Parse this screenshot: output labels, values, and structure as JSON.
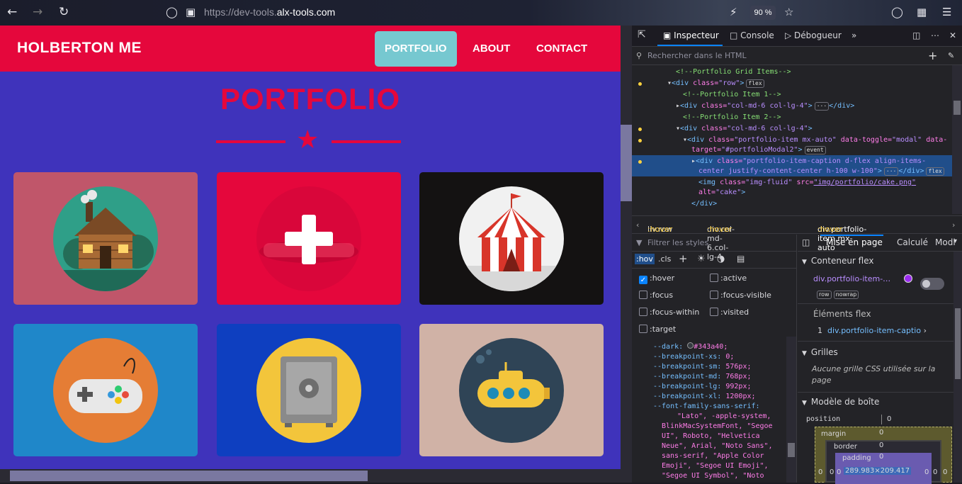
{
  "browser": {
    "url_prefix": "https://dev-tools.",
    "url_domain": "alx-tools.com",
    "zoom": "90 %"
  },
  "site": {
    "brand": "HOLBERTON ME",
    "nav": [
      "PORTFOLIO",
      "ABOUT",
      "CONTACT"
    ],
    "section_title": "PORTFOLIO",
    "colors": {
      "navbar": "#e5073c",
      "page": "#3f33bb",
      "active_nav": "#76c8d0"
    },
    "items": [
      {
        "icon": "cabin-icon",
        "bg": "#c0566a"
      },
      {
        "icon": "cake-icon",
        "bg": "#e5073c"
      },
      {
        "icon": "circus-tent-icon",
        "bg": "#141212"
      },
      {
        "icon": "game-controller-icon",
        "bg": "#1f87c9"
      },
      {
        "icon": "safe-icon",
        "bg": "#0e3fc0"
      },
      {
        "icon": "submarine-icon",
        "bg": "#d0b2a6"
      }
    ]
  },
  "devtools": {
    "tabs": [
      "Inspecteur",
      "Console",
      "Débogueur"
    ],
    "search_placeholder": "Rechercher dans le HTML",
    "tree": {
      "l1": "<!--Portfolio Grid Items-->",
      "l2_tag": "<div ",
      "l2_attr": "class=",
      "l2_val": "\"row\"",
      "l2_end": ">",
      "l2_badge": "flex",
      "l3": "<!--Portfolio Item 1-->",
      "l4_tag": "<div ",
      "l4_attr": "class=",
      "l4_val": "\"col-md-6 col-lg-4\"",
      "l4_end": ">",
      "l4_close": "</div>",
      "l4_badge": "···",
      "l5": "<!--Portfolio Item 2-->",
      "l6_tag": "<div ",
      "l6_attr": "class=",
      "l6_val": "\"col-md-6 col-lg-4\"",
      "l6_end": ">",
      "l7_tag": "<div ",
      "l7_attr": "class=",
      "l7_val": "\"portfolio-item mx-auto\"",
      "l7_attr2": " data-toggle=",
      "l7_val2": "\"modal\"",
      "l7_attr3": " data-",
      "l8_attr": "target=",
      "l8_val": "\"#portfolioModal2\"",
      "l8_end": ">",
      "l8_badge": "event",
      "l9_tag": "<div ",
      "l9_attr": "class=",
      "l9_val": "\"portfolio-item-caption d-flex align-items-",
      "l10_val": "center justify-content-center h-100 w-100\"",
      "l10_end": ">",
      "l10_dots": "···",
      "l10_close": "</div>",
      "l10_badge": "flex",
      "l11_tag": "<img ",
      "l11_attr": "class=",
      "l11_val": "\"img-fluid\"",
      "l11_attr2": " src=",
      "l11_val2": "\"img/portfolio/cake.png\"",
      "l12_attr": "alt=",
      "l12_val": "\"cake\"",
      "l12_end": ">",
      "l13": "</div>"
    },
    "breadcrumb": [
      {
        "text": "liv.row",
        "pseudo": ":hover"
      },
      {
        "text": "div.col-md-6.col-lg-4",
        "pseudo": ":hover"
      },
      {
        "text": "div.portfolio-item.mx-auto",
        "pseudo": ":hover"
      }
    ],
    "rules": {
      "filter_placeholder": "Filtrer les styles",
      "hov": ":hov",
      "cls": ".cls",
      "pseudo": [
        ":hover",
        ":active",
        ":focus",
        ":focus-visible",
        ":focus-within",
        ":visited",
        ":target"
      ],
      "vars": [
        {
          "n": "--dark:",
          "v": "#343a40;"
        },
        {
          "n": "--breakpoint-xs:",
          "v": "0;"
        },
        {
          "n": "--breakpoint-sm:",
          "v": "576px;"
        },
        {
          "n": "--breakpoint-md:",
          "v": "768px;"
        },
        {
          "n": "--breakpoint-lg:",
          "v": "992px;"
        },
        {
          "n": "--breakpoint-xl:",
          "v": "1200px;"
        },
        {
          "n": "--font-family-sans-serif:",
          "v": ""
        }
      ],
      "font_lines": [
        "\"Lato\", -apple-system,",
        "BlinkMacSystemFont, \"Segoe",
        "UI\", Roboto, \"Helvetica",
        "Neue\", Arial, \"Noto Sans\",",
        "sans-serif, \"Apple Color",
        "Emoji\", \"Segoe UI Emoji\",",
        "\"Segoe UI Symbol\", \"Noto"
      ]
    },
    "layout": {
      "tabs": [
        "Mise en page",
        "Calculé",
        "Modi"
      ],
      "flex_container": "Conteneur flex",
      "flex_selector": "div.portfolio-item-…",
      "badges": [
        "row",
        "nowrap"
      ],
      "flex_items": "Éléments flex",
      "flex_item_index": "1",
      "flex_item": "div.portfolio-item-captio",
      "grids": "Grilles",
      "grids_text": "Aucune grille CSS utilisée sur la page",
      "box_model": "Modèle de boîte",
      "position": "position",
      "position_val": "0",
      "margin": "margin",
      "border": "border",
      "padding": "padding",
      "zero": "0",
      "size": "289.983×209.417"
    }
  }
}
